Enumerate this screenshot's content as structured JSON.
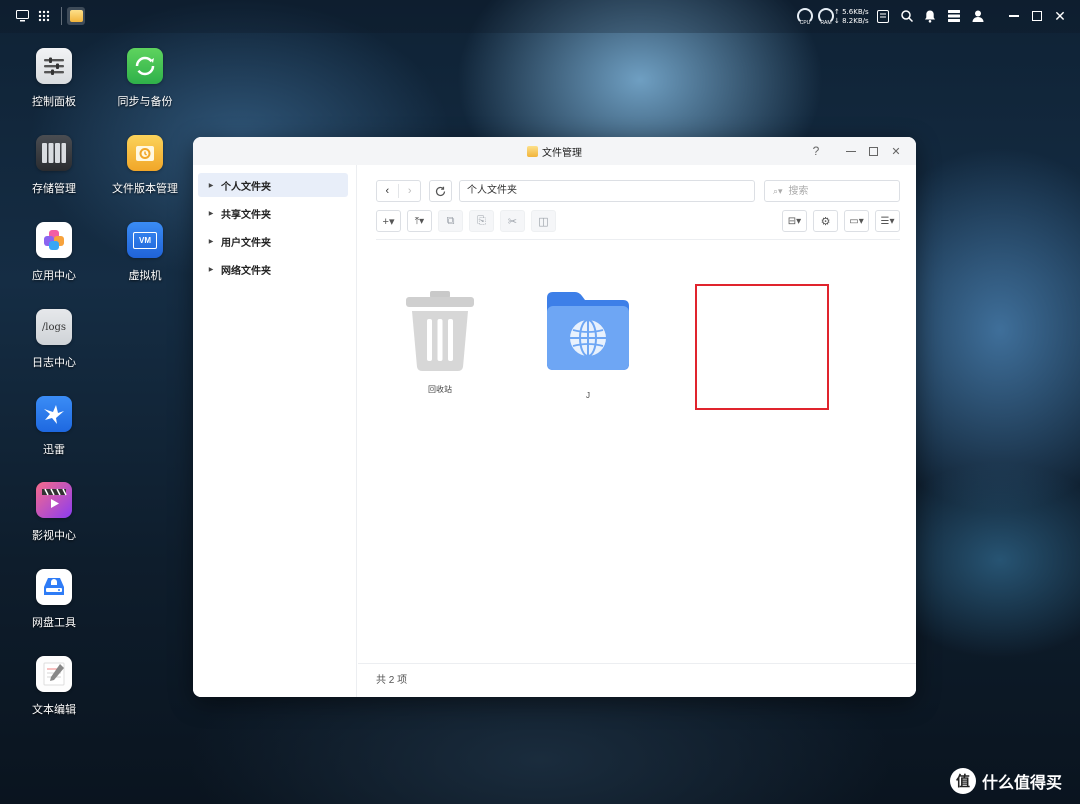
{
  "topbar": {
    "gauges": [
      "CPU",
      "RAM"
    ],
    "net_up": "↑ 5.6KB/s",
    "net_down": "↓ 8.2KB/s"
  },
  "desktop": {
    "apps": [
      {
        "label": "控制面板",
        "icon": "control-panel-icon"
      },
      {
        "label": "同步与备份",
        "icon": "sync-backup-icon"
      },
      {
        "label": "存储管理",
        "icon": "storage-icon"
      },
      {
        "label": "文件版本管理",
        "icon": "file-version-icon"
      },
      {
        "label": "应用中心",
        "icon": "app-center-icon"
      },
      {
        "label": "虚拟机",
        "icon": "vm-icon"
      },
      {
        "label": "日志中心",
        "icon": "logs-icon"
      },
      {
        "label": "迅雷",
        "icon": "thunder-icon"
      },
      {
        "label": "影视中心",
        "icon": "video-center-icon"
      },
      {
        "label": "网盘工具",
        "icon": "cloud-drive-icon"
      },
      {
        "label": "文本编辑",
        "icon": "text-editor-icon"
      }
    ],
    "vm_text": "VM",
    "logs_text": "/logs"
  },
  "window": {
    "title": "文件管理",
    "sidebar": [
      {
        "label": "个人文件夹",
        "active": true
      },
      {
        "label": "共享文件夹",
        "active": false
      },
      {
        "label": "用户文件夹",
        "active": false
      },
      {
        "label": "网络文件夹",
        "active": false
      }
    ],
    "path": "个人文件夹",
    "search_placeholder": "搜索",
    "files": [
      {
        "name": "回收站",
        "icon": "trash-icon"
      },
      {
        "name": "J",
        "icon": "network-folder-icon"
      }
    ],
    "status": "共 2 项"
  },
  "watermark": {
    "badge": "值",
    "text": "什么值得买"
  },
  "colors": {
    "accent": "#2f7cf6",
    "highlight": "#e0242d",
    "folder": "#5b9cf5"
  }
}
